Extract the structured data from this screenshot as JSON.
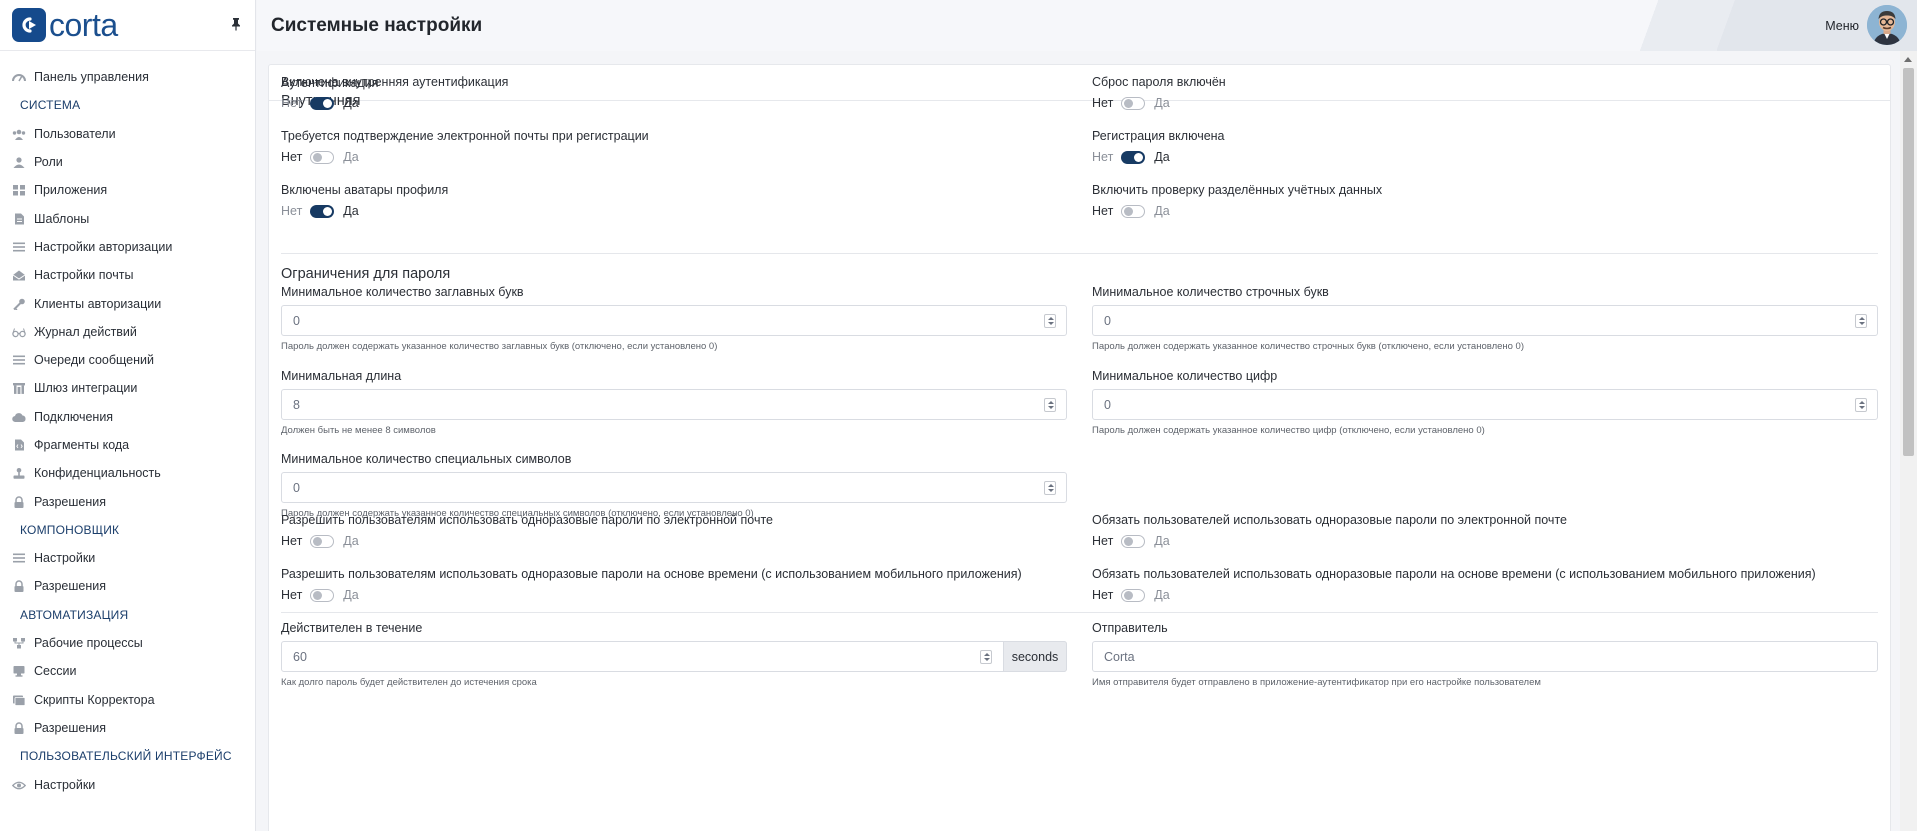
{
  "app": {
    "logo_text": "corta",
    "page_title": "Системные настройки",
    "menu_label": "Меню"
  },
  "sidebar": {
    "items": [
      {
        "type": "item",
        "label": "Панель управления",
        "icon": "dashboard-icon"
      },
      {
        "type": "section",
        "label": "СИСТЕМА"
      },
      {
        "type": "item",
        "label": "Пользователи",
        "icon": "users-icon"
      },
      {
        "type": "item",
        "label": "Роли",
        "icon": "roles-icon"
      },
      {
        "type": "item",
        "label": "Приложения",
        "icon": "apps-icon"
      },
      {
        "type": "item",
        "label": "Шаблоны",
        "icon": "template-icon"
      },
      {
        "type": "item",
        "label": "Настройки авторизации",
        "icon": "list-icon"
      },
      {
        "type": "item",
        "label": "Настройки почты",
        "icon": "mail-icon"
      },
      {
        "type": "item",
        "label": "Клиенты авторизации",
        "icon": "key-icon"
      },
      {
        "type": "item",
        "label": "Журнал действий",
        "icon": "glasses-icon"
      },
      {
        "type": "item",
        "label": "Очереди сообщений",
        "icon": "list-icon"
      },
      {
        "type": "item",
        "label": "Шлюз интеграции",
        "icon": "gateway-icon"
      },
      {
        "type": "item",
        "label": "Подключения",
        "icon": "cloud-icon"
      },
      {
        "type": "item",
        "label": "Фрагменты кода",
        "icon": "code-file-icon"
      },
      {
        "type": "item",
        "label": "Конфиденциальность",
        "icon": "privacy-icon"
      },
      {
        "type": "item",
        "label": "Разрешения",
        "icon": "lock-icon"
      },
      {
        "type": "section",
        "label": "КОМПОНОВЩИК"
      },
      {
        "type": "item",
        "label": "Настройки",
        "icon": "list-icon"
      },
      {
        "type": "item",
        "label": "Разрешения",
        "icon": "lock-icon"
      },
      {
        "type": "section",
        "label": "АВТОМАТИЗАЦИЯ"
      },
      {
        "type": "item",
        "label": "Рабочие процессы",
        "icon": "workflow-icon"
      },
      {
        "type": "item",
        "label": "Сессии",
        "icon": "sessions-icon"
      },
      {
        "type": "item",
        "label": "Скрипты Корректора",
        "icon": "script-icon"
      },
      {
        "type": "item",
        "label": "Разрешения",
        "icon": "lock-icon"
      },
      {
        "type": "section",
        "label": "ПОЛЬЗОВАТЕЛЬСКИЙ ИНТЕРФЕЙС"
      },
      {
        "type": "item",
        "label": "Настройки",
        "icon": "eye-icon"
      }
    ]
  },
  "card": {
    "title": "Аутентификация",
    "internal": {
      "title": "Внутренняя",
      "no": "Нет",
      "yes": "Да",
      "toggles": [
        {
          "label": "Включена внутренняя аутентификация",
          "on": true
        },
        {
          "label": "Сброс пароля включён",
          "on": false
        },
        {
          "label": "Требуется подтверждение электронной почты при регистрации",
          "on": false
        },
        {
          "label": "Регистрация включена",
          "on": true
        },
        {
          "label": "Включены аватары профиля",
          "on": true
        },
        {
          "label": "Включить проверку разделённых учётных данных",
          "on": false
        }
      ]
    },
    "password": {
      "title": "Ограничения для пароля",
      "fields": [
        {
          "label": "Минимальное количество заглавных букв",
          "value": "0",
          "help": "Пароль должен содержать указанное количество заглавных букв (отключено, если установлено 0)"
        },
        {
          "label": "Минимальное количество строчных букв",
          "value": "0",
          "help": "Пароль должен содержать указанное количество строчных букв (отключено, если установлено 0)"
        },
        {
          "label": "Минимальная длина",
          "value": "8",
          "help": "Должен быть не менее 8 символов"
        },
        {
          "label": "Минимальное количество цифр",
          "value": "0",
          "help": "Пароль должен содержать указанное количество цифр (отключено, если установлено 0)"
        },
        {
          "label": "Минимальное количество специальных символов",
          "value": "0",
          "help": "Пароль должен содержать указанное количество специальных символов (отключено, если установлено 0)"
        }
      ]
    },
    "otp": {
      "toggles": [
        {
          "label": "Разрешить пользователям использовать одноразовые пароли по электронной почте",
          "on": false
        },
        {
          "label": "Обязать пользователей использовать одноразовые пароли по электронной почте",
          "on": false
        },
        {
          "label": "Разрешить пользователям использовать одноразовые пароли на основе времени (с использованием мобильного приложения)",
          "on": false
        },
        {
          "label": "Обязать пользователей использовать одноразовые пароли на основе времени (с использованием мобильного приложения)",
          "on": false
        }
      ],
      "valid_for": {
        "label": "Действителен в течение",
        "value": "60",
        "addon": "seconds",
        "help": "Как долго пароль будет действителен до истечения срока"
      },
      "sender": {
        "label": "Отправитель",
        "value": "Corta",
        "help": "Имя отправителя будет отправлено в приложение-аутентификатор при его настройке пользователем"
      }
    }
  },
  "colors": {
    "brand": "#154a8c",
    "toggle_on": "#173a63",
    "section": "#1b3e6b"
  }
}
